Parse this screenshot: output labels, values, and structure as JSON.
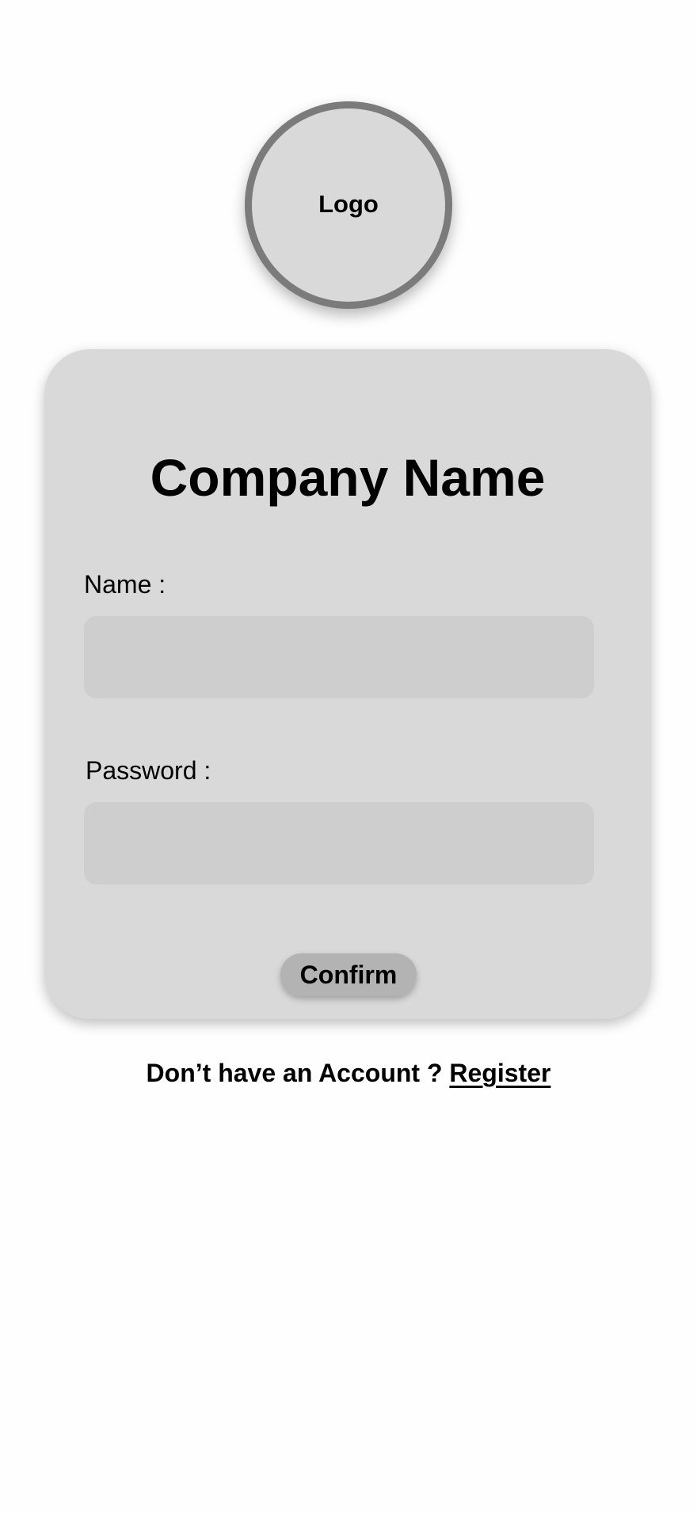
{
  "logo": {
    "text": "Logo"
  },
  "card": {
    "title": "Company Name",
    "name_label": "Name :",
    "name_value": "",
    "name_placeholder": "",
    "password_label": "Password :",
    "password_value": "",
    "password_placeholder": "",
    "confirm_label": "Confirm"
  },
  "footer": {
    "prompt": "Don’t have an Account ?",
    "register_label": "Register"
  },
  "colors": {
    "background": "#fefefe",
    "card": "#d9d9d9",
    "input": "#cecece",
    "button": "#b3b3b3",
    "logo_border": "#7b7b7b"
  }
}
